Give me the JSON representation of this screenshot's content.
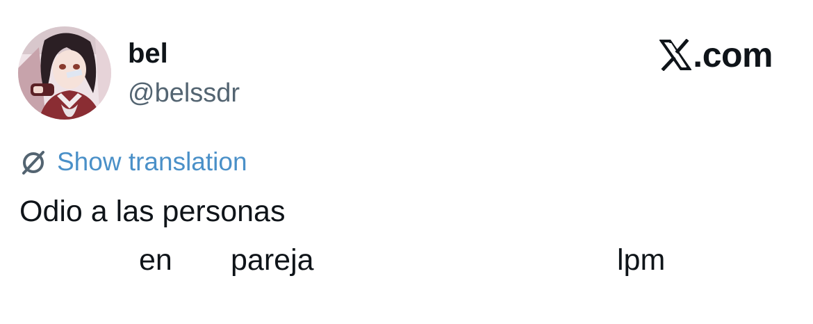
{
  "author": {
    "display_name": "bel",
    "handle": "@belssdr"
  },
  "brand": {
    "text": ".com",
    "icon": "x-logo-icon"
  },
  "translation": {
    "label": "Show translation",
    "icon": "globe-slash-icon",
    "color": "#4a90c8"
  },
  "tweet": {
    "line1": "Odio a las personas",
    "line2_words": [
      "en",
      "pareja",
      "lpm"
    ]
  },
  "colors": {
    "text": "#0f1419",
    "secondary": "#536471",
    "background": "#ffffff"
  }
}
